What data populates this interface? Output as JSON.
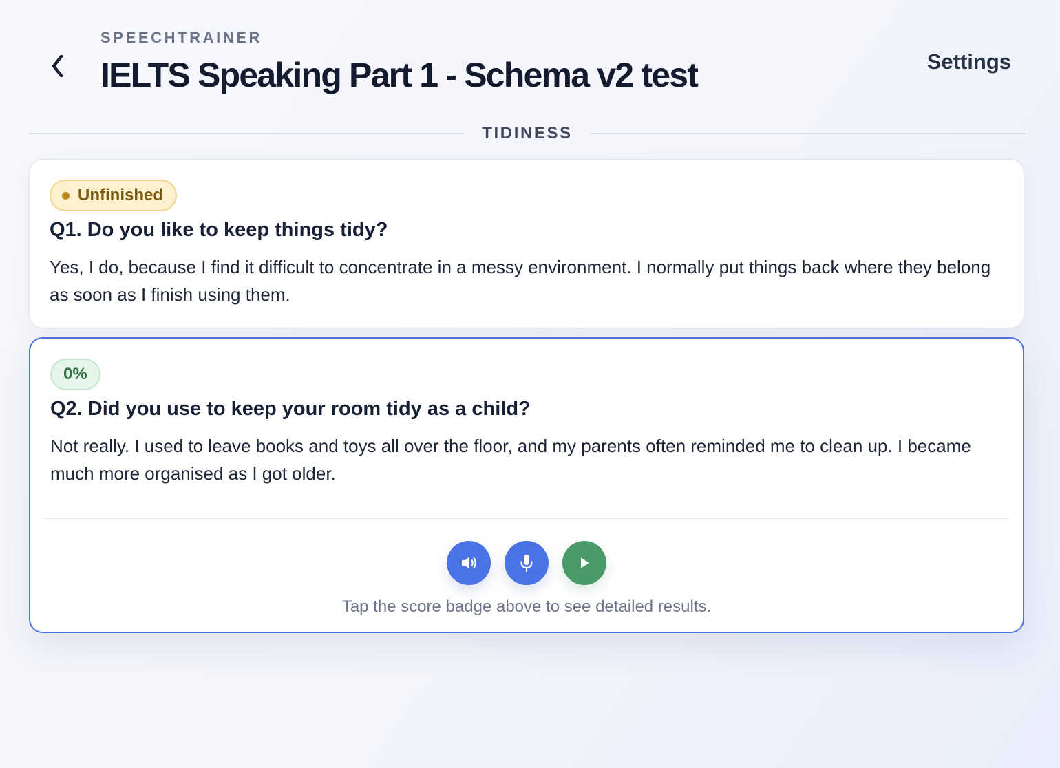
{
  "header": {
    "app_name": "SPEECHTRAINER",
    "title": "IELTS Speaking Part 1 - Schema v2 test",
    "settings_label": "Settings"
  },
  "section": {
    "title": "TIDINESS"
  },
  "questions": [
    {
      "badge": "Unfinished",
      "question": "Q1. Do you like to keep things tidy?",
      "answer": "Yes, I do, because I find it difficult to concentrate in a messy environment. I normally put things back where they belong as soon as I finish using them."
    },
    {
      "badge": "0%",
      "question": "Q2. Did you use to keep your room tidy as a child?",
      "answer": "Not really. I used to leave books and toys all over the floor, and my parents often reminded me to clean up. I became much more organised as I got older.",
      "hint": "Tap the score badge above to see detailed results."
    }
  ],
  "icons": {
    "back": "chevron-left-icon",
    "listen": "speaker-icon",
    "record": "microphone-icon",
    "play": "play-icon"
  },
  "colors": {
    "accent": "#4a74e6",
    "play": "#4b9a6a",
    "unfinished_bg": "#fdf1cf",
    "score_bg": "#e6f5ea"
  }
}
